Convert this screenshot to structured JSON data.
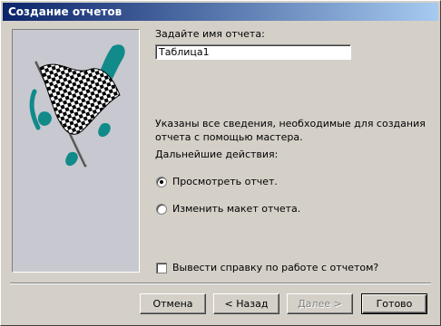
{
  "window": {
    "title": "Создание отчетов"
  },
  "form": {
    "name_label": "Задайте имя отчета:",
    "name_value": "Таблица1",
    "info_line1": "Указаны все сведения, необходимые для создания",
    "info_line2": "отчета с помощью мастера.",
    "next_actions_label": "Дальнейшие действия:",
    "options": [
      {
        "label": "Просмотреть отчет.",
        "selected": true
      },
      {
        "label": "Изменить макет отчета.",
        "selected": false
      }
    ],
    "help_checkbox": {
      "label": "Вывести справку по работе с отчетом?",
      "checked": false
    }
  },
  "buttons": {
    "cancel": "Отмена",
    "back": "< Назад",
    "next": "Далее >",
    "finish": "Готово"
  },
  "colors": {
    "titlebar_start": "#0a246a",
    "titlebar_end": "#a6caf0",
    "teal_accent": "#118a8a"
  },
  "image": {
    "icon": "checkered-flag-icon"
  }
}
